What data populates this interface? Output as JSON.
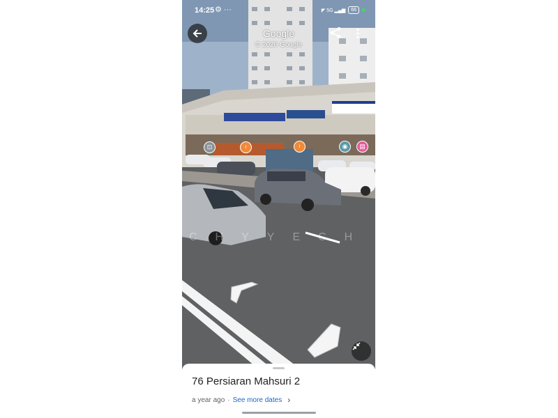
{
  "status_bar": {
    "time": "14:25",
    "extra": "⚙ ···",
    "icons": "◤ 5G ▂▄▆",
    "battery": "66"
  },
  "header": {
    "brand": "Google",
    "copyright": "© 2026 Google",
    "back_icon": "arrow-left-icon",
    "share_icon": "share-icon",
    "more_icon": "more-vert-icon"
  },
  "scene": {
    "watermark": "CHYYECH",
    "pois": [
      {
        "name": "shopping-bag-icon",
        "glyph": "⊡",
        "color": "#8a9299"
      },
      {
        "name": "restaurant-icon",
        "glyph": "ᴵ",
        "color": "#f08a3a"
      },
      {
        "name": "restaurant-icon",
        "glyph": "ᴵ",
        "color": "#f08a3a"
      },
      {
        "name": "location-pin-icon",
        "glyph": "◉",
        "color": "#5b9aa6"
      },
      {
        "name": "shop-icon",
        "glyph": "▤",
        "color": "#e35d9c"
      }
    ],
    "minimize_icon": "collapse-arrows-icon"
  },
  "sheet": {
    "title": "76 Persiaran Mahsuri 2",
    "age": "a year ago",
    "separator": "·",
    "see_more": "See more dates",
    "chevron": "›"
  }
}
